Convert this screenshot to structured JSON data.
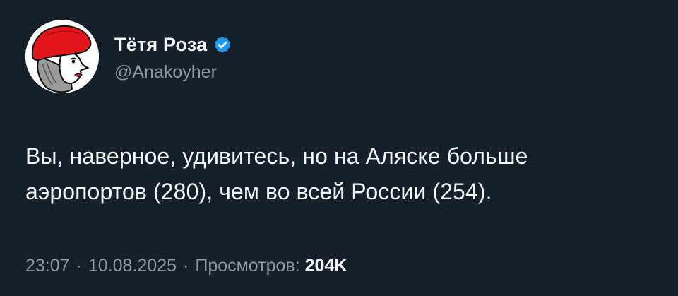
{
  "author": {
    "display_name": "Тётя Роза",
    "handle": "@Anakoyher",
    "verified": true,
    "avatar_icon": "avatar-woman-red-hat-icon",
    "verified_icon": "verified-badge-icon"
  },
  "tweet": {
    "text_line_1": "Вы, наверное, удивитесь, но на Аляске больше",
    "text_line_2": "аэропортов (280), чем во всей России (254)."
  },
  "meta": {
    "time": "23:07",
    "separator": "·",
    "date": "10.08.2025",
    "views_label": "Просмотров:",
    "views_count": "204K"
  },
  "colors": {
    "background": "#15202b",
    "primary_text": "#f4f6f8",
    "secondary_text": "#8b98a5",
    "verified_blue": "#1d9bf0",
    "hat_red": "#e3171b"
  }
}
